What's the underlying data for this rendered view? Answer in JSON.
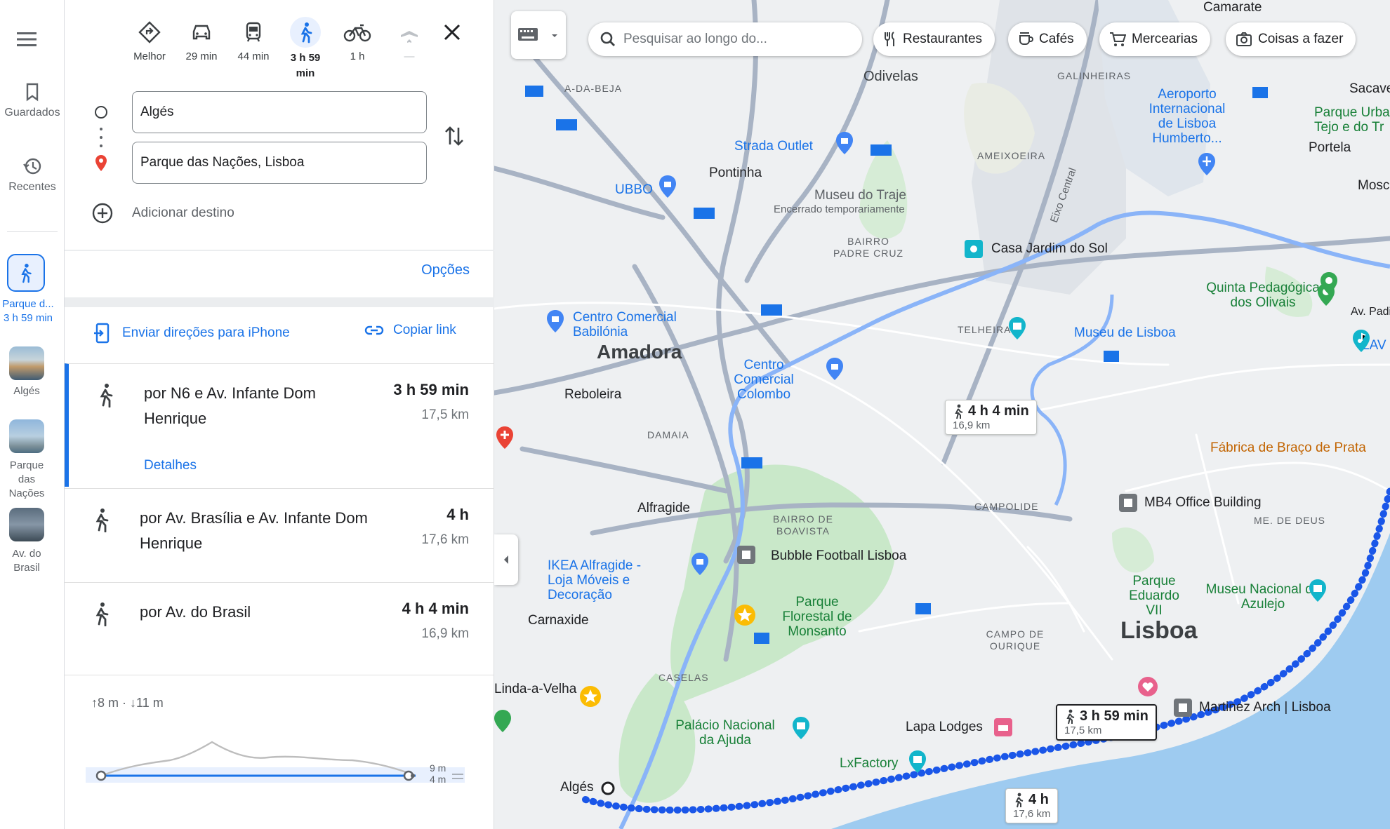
{
  "rail": {
    "saved_label": "Guardados",
    "recent_label": "Recentes",
    "active_trip_label": "Parque d...",
    "active_trip_time": "3 h 59 min",
    "places": [
      {
        "label": "Algés"
      },
      {
        "label": "Parque das Nações"
      },
      {
        "label": "Av. do Brasil"
      }
    ]
  },
  "modes": [
    {
      "label": "Melhor",
      "icon": "directions-icon"
    },
    {
      "label": "29 min",
      "icon": "car-icon"
    },
    {
      "label": "44 min",
      "icon": "transit-icon"
    },
    {
      "label": "3 h 59 min",
      "icon": "walk-icon",
      "active": true
    },
    {
      "label": "1 h",
      "icon": "bike-icon"
    },
    {
      "label": "—",
      "icon": "plane-icon"
    }
  ],
  "origin": "Algés",
  "destination": "Parque das Nações, Lisboa",
  "add_destination": "Adicionar destino",
  "options_label": "Opções",
  "send_label": "Enviar direções para iPhone",
  "copy_label": "Copiar link",
  "routes": [
    {
      "name": "por N6 e Av. Infante Dom Henrique",
      "time": "3 h 59 min",
      "distance": "17,5 km",
      "details": "Detalhes",
      "selected": true
    },
    {
      "name": "por Av. Brasília e Av. Infante Dom Henrique",
      "time": "4 h",
      "distance": "17,6 km"
    },
    {
      "name": "por Av. do Brasil",
      "time": "4 h 4 min",
      "distance": "16,9 km"
    }
  ],
  "elevation": {
    "summary_up": "8 m",
    "summary_down": "11 m",
    "max_label": "9 m",
    "min_label": "4 m"
  },
  "map": {
    "search_placeholder": "Pesquisar ao longo do...",
    "chips": [
      "Restaurantes",
      "Cafés",
      "Mercearias",
      "Coisas a fazer"
    ],
    "callouts": [
      {
        "time": "4 h 4 min",
        "distance": "16,9 km"
      },
      {
        "time": "3 h 59 min",
        "distance": "17,5 km"
      },
      {
        "time": "4 h",
        "distance": "17,6 km"
      }
    ],
    "labels": {
      "odivelas": "Odivelas",
      "galinheiras": "GALINHEIRAS",
      "camarate": "Camarate",
      "a_da_beja": "A-DA-BEJA",
      "pontinha": "Pontinha",
      "strada": "Strada Outlet",
      "ubbo": "UBBO",
      "aeroporto": "Aeroporto Internacional de Lisboa Humberto...",
      "sacave": "Sacave",
      "parque_urba": "Parque Urba Tejo e do Tr",
      "portela": "Portela",
      "mosca": "Mosca",
      "ameixoeira": "AMEIXOEIRA",
      "museu_traje": "Museu do Traje",
      "museu_traje_sub": "Encerrado temporariamente",
      "bairro_padre": "BAIRRO PADRE CRUZ",
      "eixo": "Eixo Central",
      "casa_jardim": "Casa Jardim do Sol",
      "quinta": "Quinta Pedagógica dos Olivais",
      "av_pad": "Av. Padi",
      "lav": "LAV",
      "centro_babilonia": "Centro Comercial Babilónia",
      "amadora": "Amadora",
      "telheiras": "TELHEIRAS",
      "museu_lisboa": "Museu de Lisboa",
      "centro_colombo": "Centro Comercial Colombo",
      "reboleira": "Reboleira",
      "damaia": "DAMAIA",
      "fabrica": "Fábrica de Braço de Prata",
      "campolide": "CAMPOLIDE",
      "mb4": "MB4 Office Building",
      "me_deus": "ME. DE DEUS",
      "alfragide": "Alfragide",
      "bairro_boavista": "BAIRRO DE BOAVISTA",
      "bubble": "Bubble Football Lisboa",
      "ikea": "IKEA Alfragide - Loja Móveis e Decoração",
      "parque_eduardo": "Parque Eduardo VII",
      "museu_azulejo": "Museu Nacional do Azulejo",
      "carnaxide": "Carnaxide",
      "monsanto": "Parque Florestal de Monsanto",
      "campo_ourique": "CAMPO DE OURIQUE",
      "lisboa": "Lisboa",
      "linda": "Linda-a-Velha",
      "caselas": "CASELAS",
      "martinez": "Martinez Arch | Lisboa",
      "palacio": "Palácio Nacional da Ajuda",
      "lapa": "Lapa Lodges",
      "lxfactory": "LxFactory",
      "alges": "Algés"
    }
  },
  "colors": {
    "accent": "#1a73e8",
    "route": "#1a56e8",
    "route_alt": "#8ab4f8"
  }
}
